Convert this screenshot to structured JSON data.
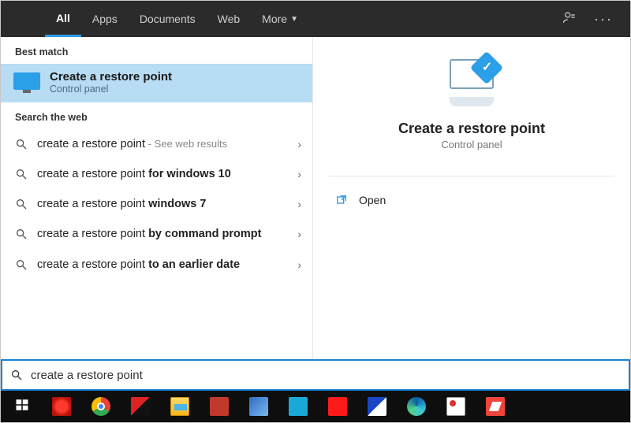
{
  "tabs": {
    "all": "All",
    "apps": "Apps",
    "documents": "Documents",
    "web": "Web",
    "more": "More",
    "active": "all"
  },
  "best_match_label": "Best match",
  "best_match": {
    "title": "Create a restore point",
    "subtitle": "Control panel"
  },
  "web_label": "Search the web",
  "web": [
    {
      "prefix": "create a restore point",
      "bold": "",
      "hint": " - See web results"
    },
    {
      "prefix": "create a restore point ",
      "bold": "for windows 10",
      "hint": ""
    },
    {
      "prefix": "create a restore point ",
      "bold": "windows 7",
      "hint": ""
    },
    {
      "prefix": "create a restore point ",
      "bold": "by command prompt",
      "hint": ""
    },
    {
      "prefix": "create a restore point ",
      "bold": "to an earlier date",
      "hint": ""
    }
  ],
  "detail": {
    "title": "Create a restore point",
    "subtitle": "Control panel",
    "open": "Open"
  },
  "search": {
    "value": "create a restore point"
  },
  "taskbar_icons": [
    "start",
    "huawei",
    "chrome",
    "usb",
    "explorer",
    "pdf",
    "app-blue",
    "app-cyan",
    "app-red",
    "app-half",
    "edge",
    "snip",
    "anydesk"
  ],
  "colors": {
    "accent": "#1a82d6",
    "selection": "#b7dcf4"
  }
}
